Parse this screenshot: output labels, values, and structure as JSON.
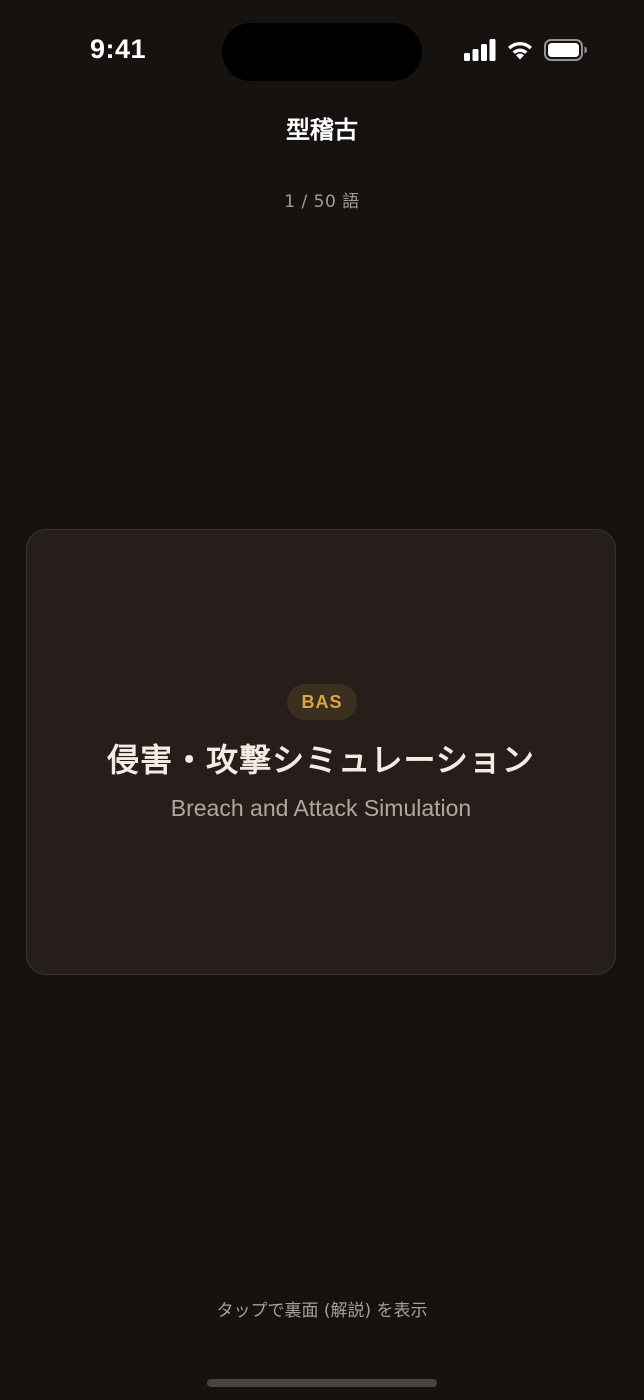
{
  "status_bar": {
    "time": "9:41",
    "icons": [
      "signal-icon",
      "wifi-icon",
      "battery-icon"
    ]
  },
  "header": {
    "title": "型稽古",
    "progress": "1 / 50 語"
  },
  "card": {
    "abbreviation": "BAS",
    "term_japanese": "侵害・攻撃シミュレーション",
    "term_english": "Breach and Attack Simulation"
  },
  "footer": {
    "hint": "タップで裏面 (解説) を表示"
  },
  "colors": {
    "background": "#161210",
    "card": "#251e1a",
    "accent": "#d7a74a"
  }
}
